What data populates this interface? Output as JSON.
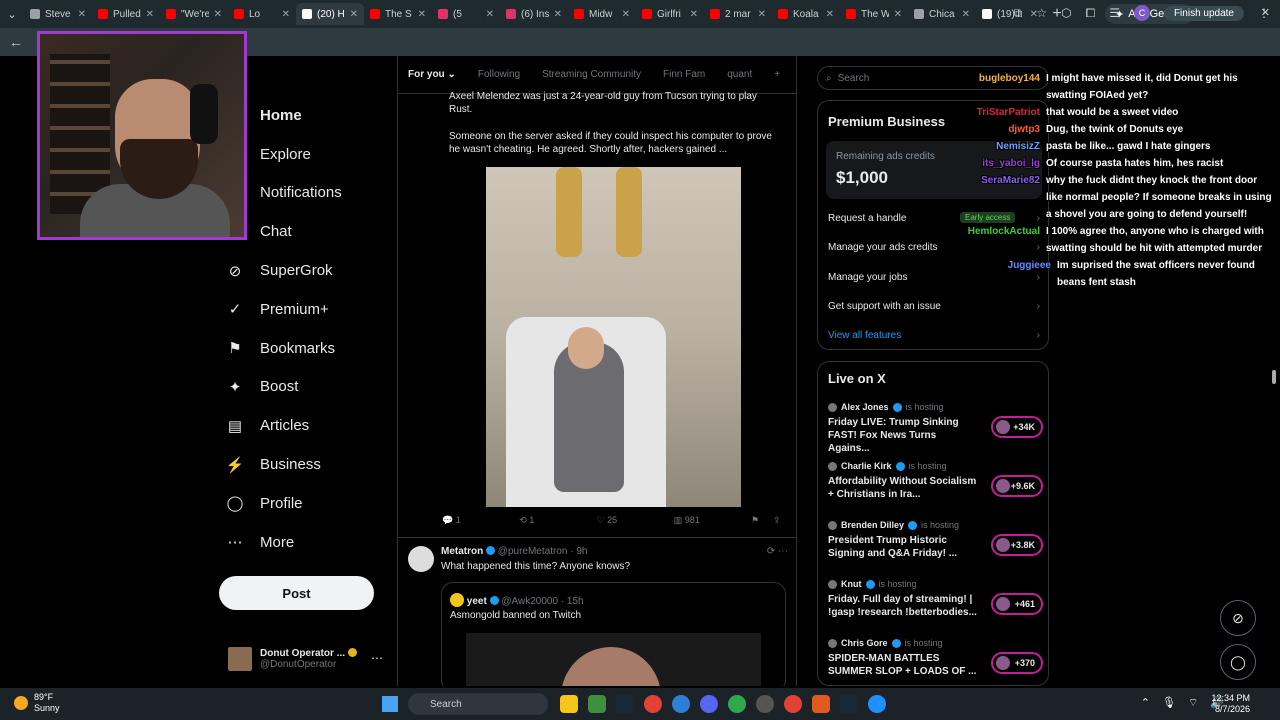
{
  "browser": {
    "tabs": [
      {
        "title": "Steve",
        "color": "#9aa0a6",
        "active": false
      },
      {
        "title": "Pulled",
        "color": "#ff0000",
        "active": false
      },
      {
        "title": "\"We're",
        "color": "#ff0000",
        "active": false
      },
      {
        "title": "Lo",
        "color": "#ff0000",
        "active": false
      },
      {
        "title": "(20) H",
        "color": "#ffffff",
        "active": true
      },
      {
        "title": "The S",
        "color": "#ff0000",
        "active": false
      },
      {
        "title": "(5",
        "color": "#e1306c",
        "active": false
      },
      {
        "title": "(6) Ins",
        "color": "#e1306c",
        "active": false
      },
      {
        "title": "Midw",
        "color": "#ff0000",
        "active": false
      },
      {
        "title": "Girlfri",
        "color": "#ff0000",
        "active": false
      },
      {
        "title": "2 mar",
        "color": "#ff0000",
        "active": false
      },
      {
        "title": "Koala",
        "color": "#ff0000",
        "active": false
      },
      {
        "title": "The W",
        "color": "#ff0000",
        "active": false
      },
      {
        "title": "Chica",
        "color": "#9aa0a6",
        "active": false
      },
      {
        "title": "(19) l",
        "color": "#ffffff",
        "active": false
      }
    ],
    "new_tab": "+",
    "ask_gemini": "Ask Gemini",
    "finish_update": "Finish update",
    "profile_letter": "C"
  },
  "nav": {
    "items": [
      {
        "label": "Home",
        "icon": "⌂",
        "name": "home"
      },
      {
        "label": "Explore",
        "icon": "⌕",
        "name": "explore"
      },
      {
        "label": "Notifications",
        "icon": "🔔",
        "name": "notifications"
      },
      {
        "label": "Chat",
        "icon": "✉",
        "name": "chat"
      },
      {
        "label": "SuperGrok",
        "icon": "⊘",
        "name": "supergrok"
      },
      {
        "label": "Premium+",
        "icon": "✓",
        "name": "premium-plus"
      },
      {
        "label": "Bookmarks",
        "icon": "⚑",
        "name": "bookmarks"
      },
      {
        "label": "Boost",
        "icon": "✦",
        "name": "boost"
      },
      {
        "label": "Articles",
        "icon": "▤",
        "name": "articles"
      },
      {
        "label": "Business",
        "icon": "⚡",
        "name": "business"
      },
      {
        "label": "Profile",
        "icon": "◯",
        "name": "profile"
      },
      {
        "label": "More",
        "icon": "⋯",
        "name": "more"
      }
    ],
    "post_button": "Post",
    "account_name": "Donut Operator ...",
    "account_handle": "@DonutOperator"
  },
  "feed": {
    "tabs": [
      "For you",
      "Following",
      "Streaming Community",
      "Finn Fam",
      "quant"
    ],
    "post1": {
      "line1": "Axeel Melendez was just a 24-year-old guy from Tucson trying to play Rust.",
      "line2": "Someone on the server asked if they could inspect his computer to prove he wasn't cheating. He agreed. Shortly after, hackers gained ...",
      "replies": "1",
      "reposts": "1",
      "likes": "25",
      "views": "981"
    },
    "post2": {
      "name": "Metatron",
      "handle": "@pureMetatron · 9h",
      "text": "What happened this time? Anyone knows?",
      "quote_name": "yeet",
      "quote_handle": "@Awk20000 · 15h",
      "quote_text": "Asmongold banned on Twitch"
    }
  },
  "sidebar": {
    "search_placeholder": "Search",
    "premium": {
      "title": "Premium Business",
      "credits_label": "Remaining ads credits",
      "credits_value": "$1,000",
      "links": [
        "Request a handle",
        "Manage your ads credits",
        "Manage your jobs",
        "Get support with an issue"
      ],
      "view_all": "View all features",
      "early_access": "Early access"
    },
    "live": {
      "title": "Live on X",
      "hosting": "is hosting",
      "items": [
        {
          "host": "Alex Jones",
          "title": "Friday LIVE: Trump Sinking FAST! Fox News Turns Agains...",
          "count": "+34K"
        },
        {
          "host": "Charlie Kirk",
          "title": "Affordability Without Socialism + Christians in Ira...",
          "count": "+9.6K"
        },
        {
          "host": "Brenden Dilley",
          "title": "President Trump Historic Signing and Q&A Friday! ...",
          "count": "+3.8K"
        },
        {
          "host": "Knut",
          "title": "Friday. Full day of streaming! | !gasp !research !betterbodies...",
          "count": "+461"
        },
        {
          "host": "Chris Gore",
          "title": "SPIDER-MAN BATTLES SUMMER SLOP + LOADS OF ...",
          "count": "+370"
        }
      ]
    }
  },
  "chat": [
    {
      "user": "bugleboy144",
      "color": "#f5b342",
      "msg": "I might have missed it, did Donut get his",
      "msg2": "swatting FOIAed yet?"
    },
    {
      "user": "TriStarPatriot",
      "color": "#e0243c",
      "msg": "that would be a sweet video"
    },
    {
      "user": "djwtp3",
      "color": "#ff5a36",
      "msg": "Dug, the twink of Donuts eye"
    },
    {
      "user": "NemisizZ",
      "color": "#6aa0ff",
      "msg": "pasta be like... gawd I hate gingers"
    },
    {
      "user": "its_yaboi_lg",
      "color": "#9f3bd8",
      "msg": "Of course pasta hates him, hes racist"
    },
    {
      "user": "SeraMarie82",
      "color": "#8c5cf0",
      "msg": "why the fuck didnt they knock the front door",
      "msg2": "like normal people? If someone breaks in using",
      "msg3": "a shovel you are going to defend yourself!"
    },
    {
      "user": "HemlockActual",
      "color": "#3ccf3c",
      "msg": "I 100% agree tho, anyone who is charged with",
      "msg2": "swatting should be hit with attempted murder"
    },
    {
      "user": "Juggieee",
      "color": "#6b8cff",
      "msg": "Im suprised the swat officers never found",
      "msg2": "beans fent stash"
    }
  ],
  "taskbar": {
    "temp": "89°F",
    "condition": "Sunny",
    "search": "Search",
    "time": "12:34 PM",
    "date": "8/7/2026"
  }
}
